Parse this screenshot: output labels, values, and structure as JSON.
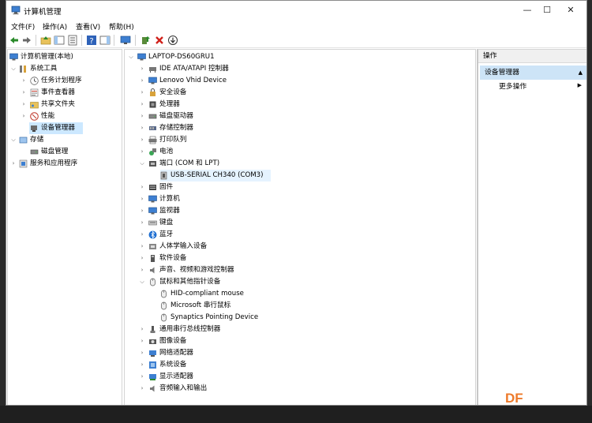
{
  "window": {
    "title": "计算机管理",
    "controls": {
      "minimize": "—",
      "maximize": "☐",
      "close": "✕"
    }
  },
  "menu": [
    "文件(F)",
    "操作(A)",
    "查看(V)",
    "帮助(H)"
  ],
  "left_tree": {
    "root": "计算机管理(本地)",
    "items": [
      {
        "label": "系统工具",
        "level": 1,
        "expanded": true
      },
      {
        "label": "任务计划程序",
        "level": 2
      },
      {
        "label": "事件查看器",
        "level": 2
      },
      {
        "label": "共享文件夹",
        "level": 2
      },
      {
        "label": "性能",
        "level": 2
      },
      {
        "label": "设备管理器",
        "level": 2,
        "selected": true
      },
      {
        "label": "存储",
        "level": 1,
        "expanded": true
      },
      {
        "label": "磁盘管理",
        "level": 2
      },
      {
        "label": "服务和应用程序",
        "level": 1
      }
    ]
  },
  "device_tree": {
    "root": "LAPTOP-DS60GRU1",
    "items": [
      {
        "label": "IDE ATA/ATAPI 控制器",
        "level": 1,
        "icon": "ide-controller-icon"
      },
      {
        "label": "Lenovo Vhid Device",
        "level": 1,
        "icon": "monitor-icon"
      },
      {
        "label": "安全设备",
        "level": 1,
        "icon": "security-device-icon"
      },
      {
        "label": "处理器",
        "level": 1,
        "icon": "processor-icon"
      },
      {
        "label": "磁盘驱动器",
        "level": 1,
        "icon": "disk-drive-icon"
      },
      {
        "label": "存储控制器",
        "level": 1,
        "icon": "storage-controller-icon"
      },
      {
        "label": "打印队列",
        "level": 1,
        "icon": "printer-icon"
      },
      {
        "label": "电池",
        "level": 1,
        "icon": "battery-icon"
      },
      {
        "label": "端口 (COM 和 LPT)",
        "level": 1,
        "expanded": true,
        "icon": "port-icon"
      },
      {
        "label": "USB-SERIAL CH340 (COM3)",
        "level": 2,
        "highlight": true,
        "icon": "serial-port-icon"
      },
      {
        "label": "固件",
        "level": 1,
        "icon": "firmware-icon"
      },
      {
        "label": "计算机",
        "level": 1,
        "icon": "computer-icon"
      },
      {
        "label": "监视器",
        "level": 1,
        "icon": "monitor-icon"
      },
      {
        "label": "键盘",
        "level": 1,
        "icon": "keyboard-icon"
      },
      {
        "label": "蓝牙",
        "level": 1,
        "icon": "bluetooth-icon"
      },
      {
        "label": "人体学输入设备",
        "level": 1,
        "icon": "hid-icon"
      },
      {
        "label": "软件设备",
        "level": 1,
        "icon": "software-device-icon"
      },
      {
        "label": "声音、视频和游戏控制器",
        "level": 1,
        "icon": "audio-icon"
      },
      {
        "label": "鼠标和其他指针设备",
        "level": 1,
        "expanded": true,
        "icon": "mouse-icon"
      },
      {
        "label": "HID-compliant mouse",
        "level": 2,
        "icon": "mouse-icon"
      },
      {
        "label": "Microsoft 串行鼠标",
        "level": 2,
        "icon": "mouse-icon"
      },
      {
        "label": "Synaptics Pointing Device",
        "level": 2,
        "icon": "mouse-icon"
      },
      {
        "label": "通用串行总线控制器",
        "level": 1,
        "icon": "usb-icon"
      },
      {
        "label": "图像设备",
        "level": 1,
        "icon": "camera-icon"
      },
      {
        "label": "网络适配器",
        "level": 1,
        "icon": "network-adapter-icon"
      },
      {
        "label": "系统设备",
        "level": 1,
        "icon": "system-device-icon"
      },
      {
        "label": "显示适配器",
        "level": 1,
        "icon": "display-adapter-icon"
      },
      {
        "label": "音频输入和输出",
        "level": 1,
        "icon": "audio-io-icon"
      }
    ]
  },
  "actions_pane": {
    "header": "操作",
    "selected": "设备管理器",
    "more": "更多操作"
  },
  "watermark": "DF",
  "colors": {
    "selection": "#cce8ff",
    "highlight": "#e5f3ff",
    "accent": "#0078d7"
  }
}
